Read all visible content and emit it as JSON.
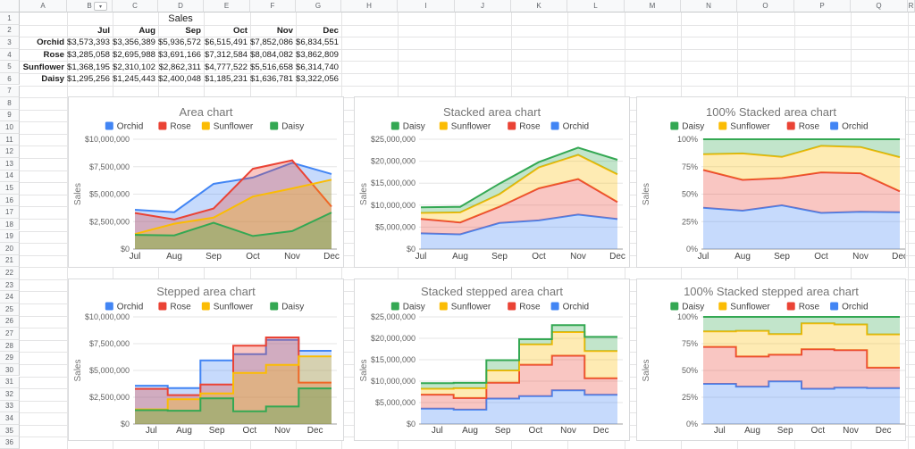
{
  "spreadsheet": {
    "column_headers": [
      "A",
      "B",
      "C",
      "D",
      "E",
      "F",
      "G",
      "H",
      "I",
      "J",
      "K",
      "L",
      "M",
      "N",
      "O",
      "P",
      "Q",
      "R"
    ],
    "row_count": 36,
    "column_dropdown": {
      "column": "B",
      "glyph": "▾"
    },
    "table": {
      "title": "Sales",
      "months": [
        "Jul",
        "Aug",
        "Sep",
        "Oct",
        "Nov",
        "Dec"
      ],
      "rows": [
        {
          "name": "Orchid",
          "values": [
            "$3,573,393",
            "$3,356,389",
            "$5,936,572",
            "$6,515,491",
            "$7,852,086",
            "$6,834,551"
          ]
        },
        {
          "name": "Rose",
          "values": [
            "$3,285,058",
            "$2,695,988",
            "$3,691,166",
            "$7,312,584",
            "$8,084,082",
            "$3,862,809"
          ]
        },
        {
          "name": "Sunflower",
          "values": [
            "$1,368,195",
            "$2,310,102",
            "$2,862,311",
            "$4,777,522",
            "$5,516,658",
            "$6,314,740"
          ]
        },
        {
          "name": "Daisy",
          "values": [
            "$1,295,256",
            "$1,245,443",
            "$2,400,048",
            "$1,185,231",
            "$1,636,781",
            "$3,322,056"
          ]
        }
      ]
    }
  },
  "colors": {
    "Orchid": "#4285f4",
    "Rose": "#ea4335",
    "Sunflower": "#fbbc04",
    "Daisy": "#34a853"
  },
  "chart_data": [
    {
      "type": "area",
      "stacked": false,
      "percent": false,
      "stepped": false,
      "title": "Area chart",
      "ylabel": "Sales",
      "legend_position": "top",
      "grid": true,
      "categories": [
        "Jul",
        "Aug",
        "Sep",
        "Oct",
        "Nov",
        "Dec"
      ],
      "legend": [
        "Orchid",
        "Rose",
        "Sunflower",
        "Daisy"
      ],
      "series": [
        {
          "name": "Orchid",
          "values": [
            3573393,
            3356389,
            5936572,
            6515491,
            7852086,
            6834551
          ]
        },
        {
          "name": "Rose",
          "values": [
            3285058,
            2695988,
            3691166,
            7312584,
            8084082,
            3862809
          ]
        },
        {
          "name": "Sunflower",
          "values": [
            1368195,
            2310102,
            2862311,
            4777522,
            5516658,
            6314740
          ]
        },
        {
          "name": "Daisy",
          "values": [
            1295256,
            1245443,
            2400048,
            1185231,
            1636781,
            3322056
          ]
        }
      ],
      "yticks": [
        "$0",
        "$2,500,000",
        "$5,000,000",
        "$7,500,000",
        "$10,000,000"
      ],
      "ylim": [
        0,
        10000000
      ]
    },
    {
      "type": "area",
      "stacked": true,
      "percent": false,
      "stepped": false,
      "title": "Stacked area chart",
      "ylabel": "Sales",
      "legend_position": "top",
      "grid": true,
      "categories": [
        "Jul",
        "Aug",
        "Sep",
        "Oct",
        "Nov",
        "Dec"
      ],
      "legend": [
        "Daisy",
        "Sunflower",
        "Rose",
        "Orchid"
      ],
      "series": [
        {
          "name": "Orchid",
          "values": [
            3573393,
            3356389,
            5936572,
            6515491,
            7852086,
            6834551
          ]
        },
        {
          "name": "Rose",
          "values": [
            3285058,
            2695988,
            3691166,
            7312584,
            8084082,
            3862809
          ]
        },
        {
          "name": "Sunflower",
          "values": [
            1368195,
            2310102,
            2862311,
            4777522,
            5516658,
            6314740
          ]
        },
        {
          "name": "Daisy",
          "values": [
            1295256,
            1245443,
            2400048,
            1185231,
            1636781,
            3322056
          ]
        }
      ],
      "yticks": [
        "$0",
        "$5,000,000",
        "$10,000,000",
        "$15,000,000",
        "$20,000,000",
        "$25,000,000"
      ],
      "ylim": [
        0,
        25000000
      ]
    },
    {
      "type": "area",
      "stacked": true,
      "percent": true,
      "stepped": false,
      "title": "100% Stacked area chart",
      "ylabel": "Sales",
      "legend_position": "top",
      "grid": true,
      "categories": [
        "Jul",
        "Aug",
        "Sep",
        "Oct",
        "Nov",
        "Dec"
      ],
      "legend": [
        "Daisy",
        "Sunflower",
        "Rose",
        "Orchid"
      ],
      "series": [
        {
          "name": "Orchid",
          "values": [
            3573393,
            3356389,
            5936572,
            6515491,
            7852086,
            6834551
          ]
        },
        {
          "name": "Rose",
          "values": [
            3285058,
            2695988,
            3691166,
            7312584,
            8084082,
            3862809
          ]
        },
        {
          "name": "Sunflower",
          "values": [
            1368195,
            2310102,
            2862311,
            4777522,
            5516658,
            6314740
          ]
        },
        {
          "name": "Daisy",
          "values": [
            1295256,
            1245443,
            2400048,
            1185231,
            1636781,
            3322056
          ]
        }
      ],
      "yticks": [
        "0%",
        "25%",
        "50%",
        "75%",
        "100%"
      ],
      "ylim": [
        0,
        100
      ]
    },
    {
      "type": "area",
      "stacked": false,
      "percent": false,
      "stepped": true,
      "title": "Stepped area chart",
      "ylabel": "Sales",
      "legend_position": "top",
      "grid": true,
      "categories": [
        "Jul",
        "Aug",
        "Sep",
        "Oct",
        "Nov",
        "Dec"
      ],
      "legend": [
        "Orchid",
        "Rose",
        "Sunflower",
        "Daisy"
      ],
      "series": [
        {
          "name": "Orchid",
          "values": [
            3573393,
            3356389,
            5936572,
            6515491,
            7852086,
            6834551
          ]
        },
        {
          "name": "Rose",
          "values": [
            3285058,
            2695988,
            3691166,
            7312584,
            8084082,
            3862809
          ]
        },
        {
          "name": "Sunflower",
          "values": [
            1368195,
            2310102,
            2862311,
            4777522,
            5516658,
            6314740
          ]
        },
        {
          "name": "Daisy",
          "values": [
            1295256,
            1245443,
            2400048,
            1185231,
            1636781,
            3322056
          ]
        }
      ],
      "yticks": [
        "$0",
        "$2,500,000",
        "$5,000,000",
        "$7,500,000",
        "$10,000,000"
      ],
      "ylim": [
        0,
        10000000
      ]
    },
    {
      "type": "area",
      "stacked": true,
      "percent": false,
      "stepped": true,
      "title": "Stacked stepped area chart",
      "ylabel": "Sales",
      "legend_position": "top",
      "grid": true,
      "categories": [
        "Jul",
        "Aug",
        "Sep",
        "Oct",
        "Nov",
        "Dec"
      ],
      "legend": [
        "Daisy",
        "Sunflower",
        "Rose",
        "Orchid"
      ],
      "series": [
        {
          "name": "Orchid",
          "values": [
            3573393,
            3356389,
            5936572,
            6515491,
            7852086,
            6834551
          ]
        },
        {
          "name": "Rose",
          "values": [
            3285058,
            2695988,
            3691166,
            7312584,
            8084082,
            3862809
          ]
        },
        {
          "name": "Sunflower",
          "values": [
            1368195,
            2310102,
            2862311,
            4777522,
            5516658,
            6314740
          ]
        },
        {
          "name": "Daisy",
          "values": [
            1295256,
            1245443,
            2400048,
            1185231,
            1636781,
            3322056
          ]
        }
      ],
      "yticks": [
        "$0",
        "$5,000,000",
        "$10,000,000",
        "$15,000,000",
        "$20,000,000",
        "$25,000,000"
      ],
      "ylim": [
        0,
        25000000
      ]
    },
    {
      "type": "area",
      "stacked": true,
      "percent": true,
      "stepped": true,
      "title": "100% Stacked stepped area chart",
      "ylabel": "Sales",
      "legend_position": "top",
      "grid": true,
      "categories": [
        "Jul",
        "Aug",
        "Sep",
        "Oct",
        "Nov",
        "Dec"
      ],
      "legend": [
        "Daisy",
        "Sunflower",
        "Rose",
        "Orchid"
      ],
      "series": [
        {
          "name": "Orchid",
          "values": [
            3573393,
            3356389,
            5936572,
            6515491,
            7852086,
            6834551
          ]
        },
        {
          "name": "Rose",
          "values": [
            3285058,
            2695988,
            3691166,
            7312584,
            8084082,
            3862809
          ]
        },
        {
          "name": "Sunflower",
          "values": [
            1368195,
            2310102,
            2862311,
            4777522,
            5516658,
            6314740
          ]
        },
        {
          "name": "Daisy",
          "values": [
            1295256,
            1245443,
            2400048,
            1185231,
            1636781,
            3322056
          ]
        }
      ],
      "yticks": [
        "0%",
        "25%",
        "50%",
        "75%",
        "100%"
      ],
      "ylim": [
        0,
        100
      ]
    }
  ]
}
